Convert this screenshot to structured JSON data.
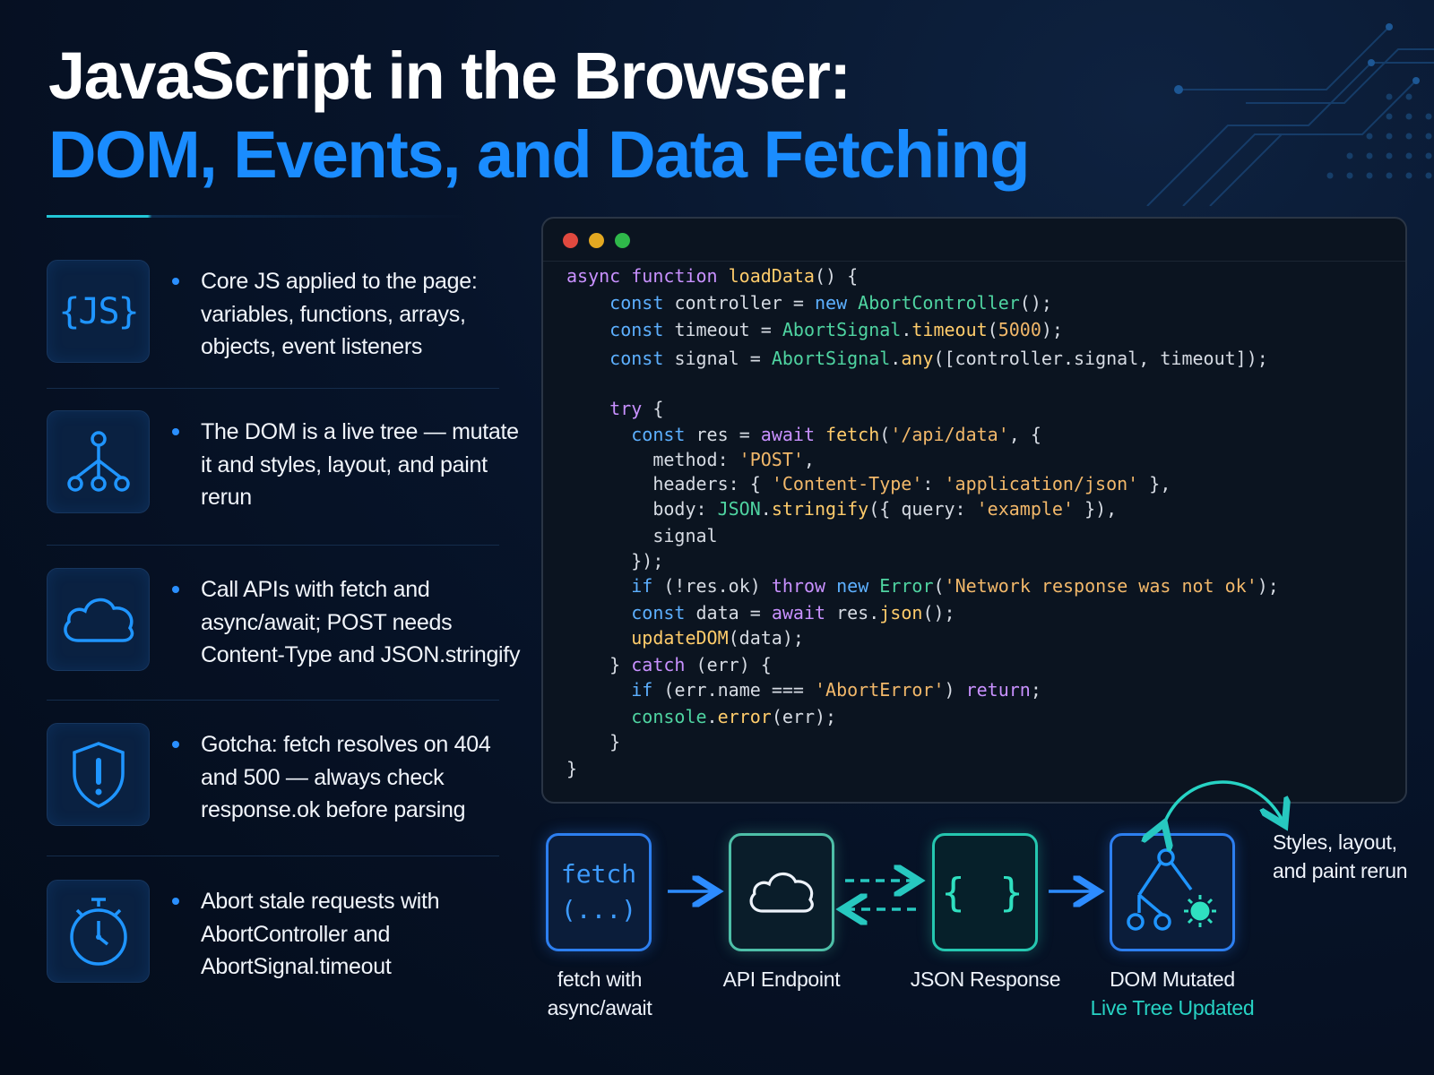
{
  "title": {
    "line1": "JavaScript in the Browser:",
    "line2": "DOM, Events, and Data Fetching"
  },
  "features": [
    {
      "icon": "js-braces-icon",
      "text": "Core JS applied to the page: variables, functions, arrays, objects, event listeners"
    },
    {
      "icon": "tree-nodes-icon",
      "text": "The DOM is a live tree — mutate it and styles, layout, and paint rerun"
    },
    {
      "icon": "cloud-icon",
      "text": "Call APIs with fetch and async/await; POST needs Content-Type and JSON.stringify"
    },
    {
      "icon": "shield-alert-icon",
      "text": "Gotcha: fetch resolves on 404 and 500 — always check response.ok before parsing"
    },
    {
      "icon": "stopwatch-icon",
      "text": "Abort stale requests with AbortController and AbortSignal.timeout"
    }
  ],
  "js_icon_label": "{JS}",
  "code": [
    "async function loadData() {",
    "    const controller = new AbortController();",
    "    const timeout = AbortSignal.timeout(5000);",
    "    const signal = AbortSignal.any([controller.signal, timeout]);",
    "",
    "    try {",
    "      const res = await fetch('/api/data', {",
    "        method: 'POST',",
    "        headers: { 'Content-Type': 'application/json' },",
    "        body: JSON.stringify({ query: 'example' }),",
    "        signal",
    "      });",
    "      if (!res.ok) throw new Error('Network response was not ok');",
    "      const data = await res.json();",
    "      updateDOM(data);",
    "    } catch (err) {",
    "      if (err.name === 'AbortError') return;",
    "      console.error(err);",
    "    }",
    "}"
  ],
  "flow": {
    "fetch_box_line1": "fetch",
    "fetch_box_line2": "(...)",
    "json_box": "{ }",
    "labels": {
      "fetch_line1": "fetch with",
      "fetch_line2": "async/await",
      "api": "API Endpoint",
      "json": "JSON Response",
      "dom": "DOM Mutated",
      "dom_sub": "Live Tree Updated"
    },
    "styles_note": "Styles, layout, and paint rerun"
  },
  "colors": {
    "background": "#07142a",
    "title_accent": "#1a8cff",
    "teal_accent": "#27d3c4",
    "code_background": "#0b1420"
  }
}
